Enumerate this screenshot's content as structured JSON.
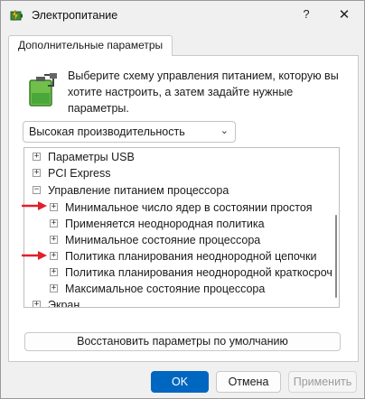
{
  "window": {
    "title": "Электропитание",
    "help_label": "?",
    "close_label": "✕"
  },
  "tab": {
    "label": "Дополнительные параметры"
  },
  "description": "Выберите схему управления питанием, которую вы хотите настроить, а затем задайте нужные параметры.",
  "plan_select": {
    "value": "Высокая производительность",
    "arrow": "⌄"
  },
  "tree": {
    "rows": [
      {
        "label": "Параметры USB",
        "expander": "+"
      },
      {
        "label": "PCI Express",
        "expander": "+"
      },
      {
        "label": "Управление питанием процессора",
        "expander": "−"
      },
      {
        "label": "Минимальное число ядер в состоянии простоя",
        "expander": "+"
      },
      {
        "label": "Применяется неоднородная политика",
        "expander": "+"
      },
      {
        "label": "Минимальное состояние процессора",
        "expander": "+"
      },
      {
        "label": "Политика планирования неоднородной цепочки",
        "expander": "+"
      },
      {
        "label": "Политика планирования неоднородной краткосроч",
        "expander": "+"
      },
      {
        "label": "Максимальное состояние процессора",
        "expander": "+"
      },
      {
        "label": "Экран",
        "expander": "+"
      }
    ]
  },
  "buttons": {
    "restore": "Восстановить параметры по умолчанию",
    "ok": "OK",
    "cancel": "Отмена",
    "apply": "Применить"
  },
  "colors": {
    "accent": "#0067c0",
    "arrow_red": "#e0202a"
  }
}
